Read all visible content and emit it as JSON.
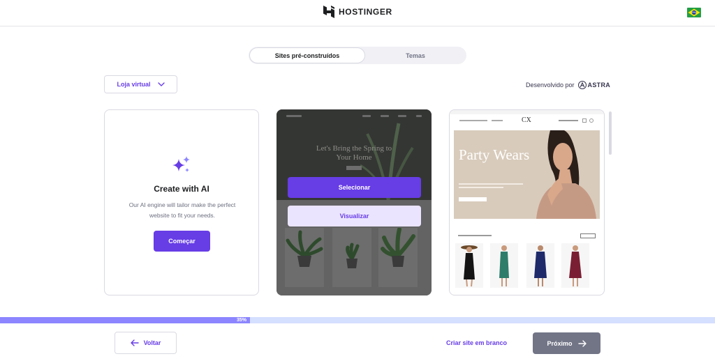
{
  "header": {
    "brand": "HOSTINGER",
    "language_flag": "brazil-flag"
  },
  "tabs": {
    "active": "Sites pré-construídos",
    "inactive": "Temas"
  },
  "filter": {
    "selected": "Loja virtual"
  },
  "powered_by": {
    "label": "Desenvolvido por",
    "brand": "ASTRA"
  },
  "ai_card": {
    "title": "Create with AI",
    "description": "Our AI engine will tailor make the perfect website to fit your needs.",
    "button": "Começar"
  },
  "template_plants": {
    "headline": "Let's Bring the Spring to Your Home",
    "select_button": "Selecionar",
    "preview_button": "Visualizar"
  },
  "template_party": {
    "logo": "CX",
    "headline": "Party Wears"
  },
  "progress": {
    "value": 0.35,
    "label": "35%"
  },
  "footer": {
    "back": "Voltar",
    "blank": "Criar site em branco",
    "next": "Próximo"
  },
  "colors": {
    "accent": "#673de6",
    "progress_fill": "#8c85ff",
    "progress_track": "#d5dfff",
    "next_disabled": "#727586"
  }
}
